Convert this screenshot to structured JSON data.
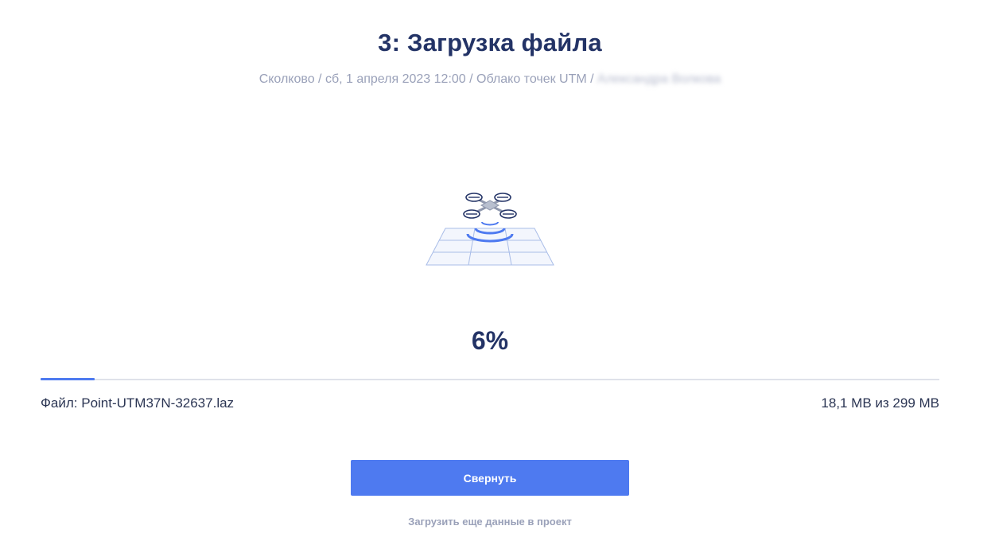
{
  "header": {
    "title": "3: Загрузка файла",
    "breadcrumb_visible": "Сколково / сб, 1 апреля 2023 12:00 / Облако точек UTM / ",
    "breadcrumb_user": "Александра Волкова"
  },
  "upload": {
    "percent_label": "6%",
    "progress_fraction": 0.06,
    "file_label": "Файл: Point-UTM37N-32637.laz",
    "size_label": "18,1 MB из 299 MB"
  },
  "actions": {
    "collapse_label": "Свернуть",
    "upload_more_label": "Загрузить еще данные в проект"
  },
  "colors": {
    "accent": "#4e7af0",
    "title": "#233366",
    "muted": "#9aa1b9"
  },
  "icons": {
    "illustration": "drone-uploading-icon"
  }
}
